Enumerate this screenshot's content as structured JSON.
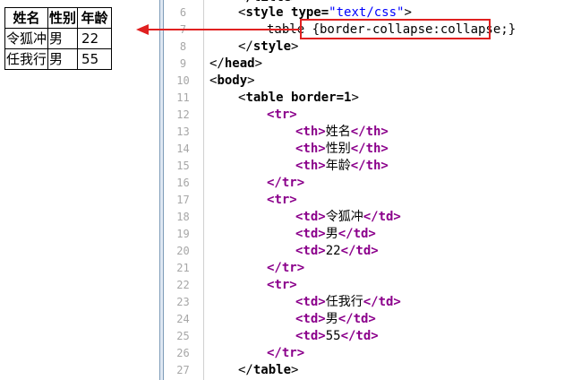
{
  "preview": {
    "headers": [
      "姓名",
      "性别",
      "年龄"
    ],
    "rows": [
      [
        "令狐冲",
        "男",
        "22"
      ],
      [
        "任我行",
        "男",
        "55"
      ]
    ]
  },
  "editor": {
    "line_numbers": [
      "6",
      "7",
      "8",
      "9",
      "10",
      "11",
      "12",
      "13",
      "14",
      "15",
      "16",
      "17",
      "18",
      "19",
      "20",
      "21",
      "22",
      "23",
      "24",
      "25",
      "26",
      "27"
    ],
    "lines": {
      "l6": {
        "open": "<",
        "tag": "style",
        "attr": " type=",
        "val": "\"text/css\"",
        "close": ">"
      },
      "l7": {
        "text": "table {border-collapse:collapse;}"
      },
      "l8": {
        "open": "</",
        "tag": "style",
        "close": ">"
      },
      "l9": {
        "open": "</",
        "tag": "head",
        "close": ">"
      },
      "l10": {
        "open": "<",
        "tag": "body",
        "close": ">"
      },
      "l11": {
        "open": "<",
        "tag": "table",
        "attr": " border=1",
        "close": ">"
      },
      "l12": {
        "open": "<",
        "tag": "tr",
        "close": ">"
      },
      "l13": {
        "tag1": "<th>",
        "text": "姓名",
        "tag2": "</th>"
      },
      "l14": {
        "tag1": "<th>",
        "text": "性别",
        "tag2": "</th>"
      },
      "l15": {
        "tag1": "<th>",
        "text": "年龄",
        "tag2": "</th>"
      },
      "l16": {
        "open": "</",
        "tag": "tr",
        "close": ">"
      },
      "l17": {
        "open": "<",
        "tag": "tr",
        "close": ">"
      },
      "l18": {
        "tag1": "<td>",
        "text": "令狐冲",
        "tag2": "</td>"
      },
      "l19": {
        "tag1": "<td>",
        "text": "男",
        "tag2": "</td>"
      },
      "l20": {
        "tag1": "<td>",
        "text": "22",
        "tag2": "</td>"
      },
      "l21": {
        "open": "</",
        "tag": "tr",
        "close": ">"
      },
      "l22": {
        "open": "<",
        "tag": "tr",
        "close": ">"
      },
      "l23": {
        "tag1": "<td>",
        "text": "任我行",
        "tag2": "</td>"
      },
      "l24": {
        "tag1": "<td>",
        "text": "男",
        "tag2": "</td>"
      },
      "l25": {
        "tag1": "<td>",
        "text": "55",
        "tag2": "</td>"
      },
      "l26": {
        "open": "</",
        "tag": "tr",
        "close": ">"
      },
      "l27": {
        "open": "</",
        "tag": "table",
        "close": ">"
      }
    }
  },
  "annotation": {
    "color": "#e02020",
    "arrow": "arrow-left-icon"
  }
}
